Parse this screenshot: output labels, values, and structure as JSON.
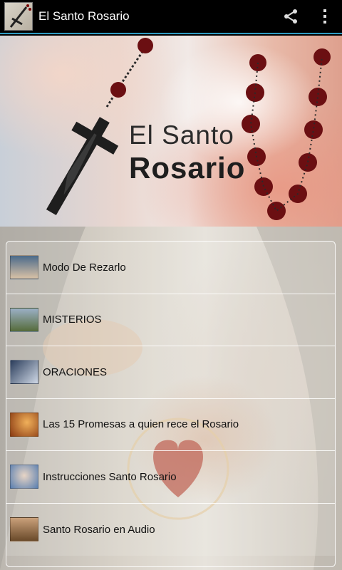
{
  "actionbar": {
    "title": "El Santo Rosario",
    "icons": [
      "app-rosary-icon",
      "share-icon",
      "overflow-menu-icon"
    ],
    "accent_color": "#2f9cc3"
  },
  "banner": {
    "line1": "El Santo",
    "line2": "Rosario"
  },
  "menu": {
    "items": [
      {
        "label": "Modo De Rezarlo",
        "thumb_colors": [
          "#4a6a8a",
          "#d9c2a6"
        ]
      },
      {
        "label": "MISTERIOS",
        "thumb_colors": [
          "#9bb0c6",
          "#556b3a"
        ]
      },
      {
        "label": "ORACIONES",
        "thumb_colors": [
          "#2b3d5b",
          "#cfd8e6"
        ]
      },
      {
        "label": "Las 15 Promesas a quien rece el Rosario",
        "thumb_colors": [
          "#8a3a12",
          "#f0b05a"
        ]
      },
      {
        "label": "Instrucciones Santo Rosario",
        "thumb_colors": [
          "#5a7fb0",
          "#e8d5c5"
        ]
      },
      {
        "label": "Santo Rosario en Audio",
        "thumb_colors": [
          "#6a4a2a",
          "#c9a07a"
        ]
      }
    ]
  }
}
